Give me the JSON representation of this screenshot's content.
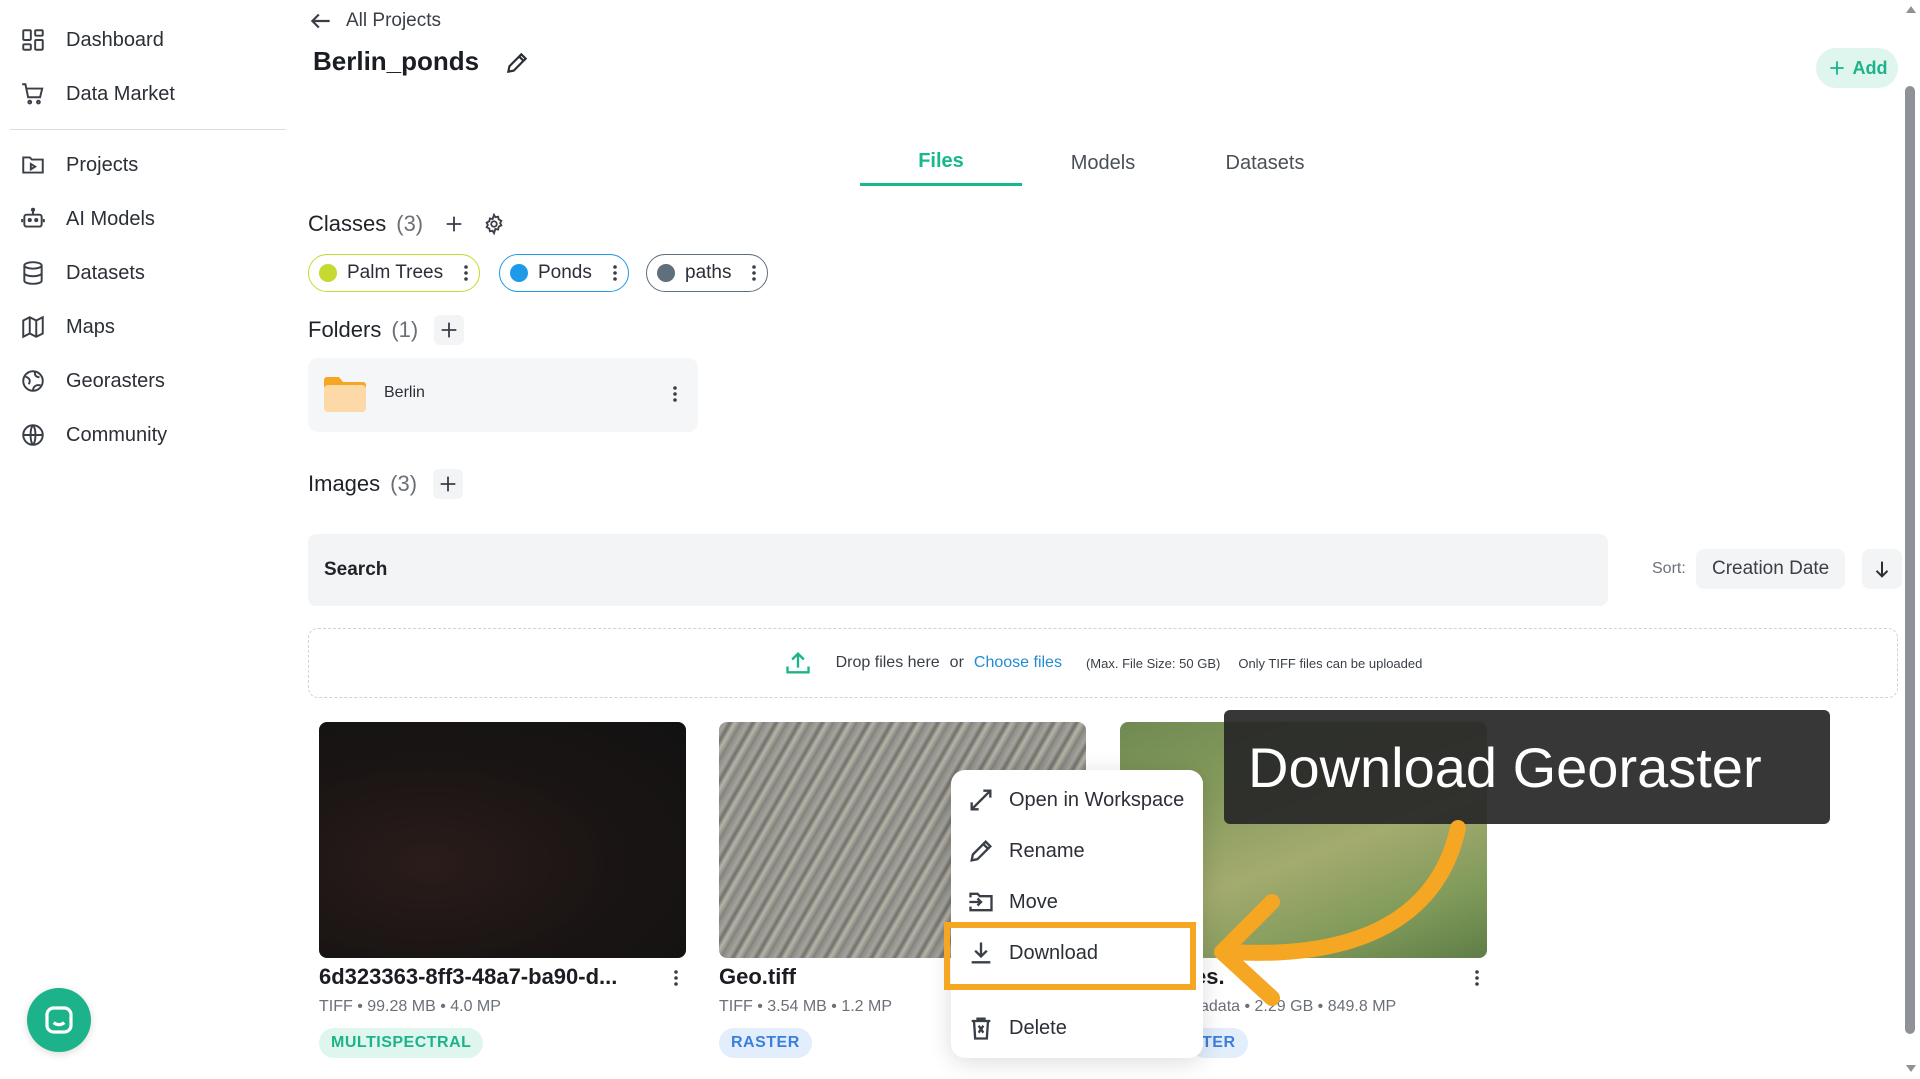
{
  "sidebar": {
    "items": [
      {
        "label": "Dashboard",
        "icon": "dashboard-icon"
      },
      {
        "label": "Data Market",
        "icon": "cart-icon"
      },
      {
        "label": "Projects",
        "icon": "projects-icon"
      },
      {
        "label": "AI Models",
        "icon": "robot-icon"
      },
      {
        "label": "Datasets",
        "icon": "database-icon"
      },
      {
        "label": "Maps",
        "icon": "map-icon"
      },
      {
        "label": "Georasters",
        "icon": "globe-grid-icon"
      },
      {
        "label": "Community",
        "icon": "globe-icon"
      }
    ]
  },
  "header": {
    "back_label": "All Projects",
    "project_title": "Berlin_ponds",
    "add_label": "Add"
  },
  "tabs": [
    {
      "label": "Files",
      "active": true
    },
    {
      "label": "Models",
      "active": false
    },
    {
      "label": "Datasets",
      "active": false
    }
  ],
  "classes": {
    "title": "Classes",
    "count": "(3)",
    "items": [
      {
        "label": "Palm Trees",
        "color": "#c5d92f",
        "border": "#c5d92f"
      },
      {
        "label": "Ponds",
        "color": "#1e9ae8",
        "border": "#1e9ae8"
      },
      {
        "label": "paths",
        "color": "#5f6f7c",
        "border": "#5f6f7c"
      }
    ]
  },
  "folders": {
    "title": "Folders",
    "count": "(1)",
    "items": [
      {
        "name": "Berlin"
      }
    ]
  },
  "images": {
    "title": "Images",
    "count": "(3)",
    "search_label": "Search",
    "sort_label": "Sort:",
    "sort_value": "Creation Date",
    "dropzone": {
      "text": "Drop files here",
      "or": "or",
      "link": "Choose files",
      "max_size": "(Max. File Size: 50 GB)",
      "note": "Only TIFF files can be uploaded"
    },
    "cards": [
      {
        "title": "6d323363-8ff3-48a7-ba90-d...",
        "meta": "TIFF • 99.28 MB • 4.0 MP",
        "badge": "MULTISPECTRAL"
      },
      {
        "title": "Geo.tiff",
        "meta": "TIFF • 3.54 MB • 1.2 MP",
        "badge": "RASTER"
      },
      {
        "title": "es.",
        "meta": "adata • 2.29 GB • 849.8 MP",
        "badge": "TER"
      }
    ]
  },
  "context_menu": {
    "items": [
      {
        "label": "Open in Workspace",
        "icon": "expand-icon"
      },
      {
        "label": "Rename",
        "icon": "pencil-icon"
      },
      {
        "label": "Move",
        "icon": "move-icon"
      },
      {
        "label": "Download",
        "icon": "download-icon"
      },
      {
        "label": "Delete",
        "icon": "trash-icon"
      }
    ]
  },
  "tooltip": {
    "text": "Download Georaster"
  },
  "colors": {
    "accent": "#17b88c",
    "highlight": "#f5a623"
  }
}
